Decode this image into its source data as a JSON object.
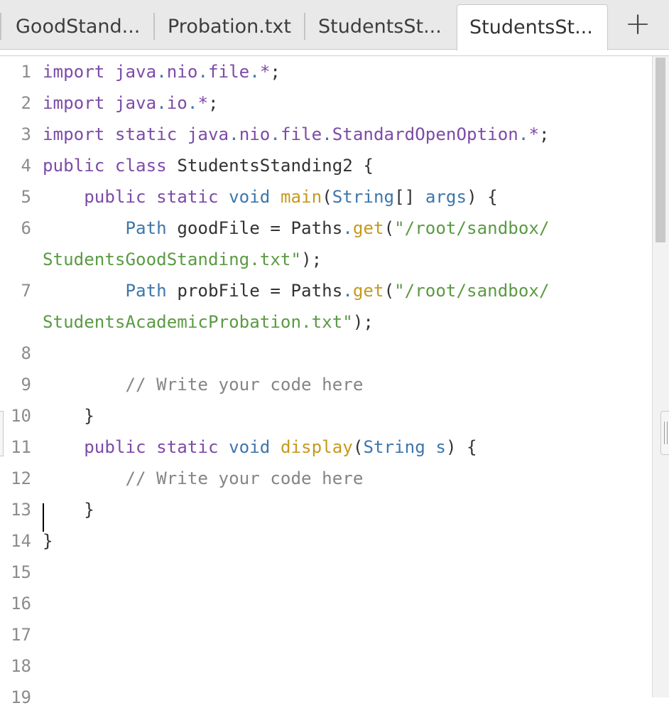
{
  "tabs": [
    {
      "label": "GoodStand...",
      "active": false
    },
    {
      "label": "Probation.txt",
      "active": false
    },
    {
      "label": "StudentsSt...",
      "active": false
    },
    {
      "label": "StudentsSt...",
      "active": true
    }
  ],
  "add_tab_label": "+",
  "editor": {
    "line_numbers": [
      "1",
      "2",
      "3",
      "4",
      "5",
      "6",
      "7",
      "8",
      "9",
      "10",
      "11",
      "12",
      "13",
      "14",
      "15",
      "16",
      "17",
      "18",
      "19"
    ],
    "lines": [
      [
        {
          "t": "import ",
          "c": "kw"
        },
        {
          "t": "java",
          "c": "kw"
        },
        {
          "t": ".",
          "c": "ty"
        },
        {
          "t": "nio",
          "c": "kw"
        },
        {
          "t": ".",
          "c": "ty"
        },
        {
          "t": "file",
          "c": "kw"
        },
        {
          "t": ".",
          "c": "ty"
        },
        {
          "t": "*",
          "c": "kw"
        },
        {
          "t": ";",
          "c": "pl"
        }
      ],
      [
        {
          "t": "import ",
          "c": "kw"
        },
        {
          "t": "java",
          "c": "kw"
        },
        {
          "t": ".",
          "c": "ty"
        },
        {
          "t": "io",
          "c": "kw"
        },
        {
          "t": ".",
          "c": "ty"
        },
        {
          "t": "*",
          "c": "kw"
        },
        {
          "t": ";",
          "c": "pl"
        }
      ],
      [
        {
          "t": "import static ",
          "c": "kw"
        },
        {
          "t": "java",
          "c": "kw"
        },
        {
          "t": ".",
          "c": "ty"
        },
        {
          "t": "nio",
          "c": "kw"
        },
        {
          "t": ".",
          "c": "ty"
        },
        {
          "t": "file",
          "c": "kw"
        },
        {
          "t": ".",
          "c": "ty"
        },
        {
          "t": "StandardOpenOption",
          "c": "kw"
        },
        {
          "t": ".",
          "c": "ty"
        },
        {
          "t": "*",
          "c": "kw"
        },
        {
          "t": ";",
          "c": "pl"
        }
      ],
      [
        {
          "t": "public class ",
          "c": "kw"
        },
        {
          "t": "StudentsStanding2 {",
          "c": "pl"
        }
      ],
      [
        {
          "t": "    ",
          "c": "pl"
        },
        {
          "t": "public static ",
          "c": "kw"
        },
        {
          "t": "void ",
          "c": "ty"
        },
        {
          "t": "main",
          "c": "fn"
        },
        {
          "t": "(",
          "c": "pl"
        },
        {
          "t": "String",
          "c": "ty"
        },
        {
          "t": "[] ",
          "c": "pl"
        },
        {
          "t": "args",
          "c": "ty"
        },
        {
          "t": ") {",
          "c": "pl"
        }
      ],
      [
        {
          "t": "        ",
          "c": "pl"
        },
        {
          "t": "Path ",
          "c": "ty"
        },
        {
          "t": "goodFile = Paths",
          "c": "pl"
        },
        {
          "t": ".",
          "c": "ty"
        },
        {
          "t": "get",
          "c": "fn"
        },
        {
          "t": "(",
          "c": "pl"
        },
        {
          "t": "\"/root/sandbox/",
          "c": "str"
        }
      ],
      [
        {
          "t": "StudentsGoodStanding.txt\"",
          "c": "str"
        },
        {
          "t": ");",
          "c": "pl"
        }
      ],
      [
        {
          "t": "        ",
          "c": "pl"
        },
        {
          "t": "Path ",
          "c": "ty"
        },
        {
          "t": "probFile = Paths",
          "c": "pl"
        },
        {
          "t": ".",
          "c": "ty"
        },
        {
          "t": "get",
          "c": "fn"
        },
        {
          "t": "(",
          "c": "pl"
        },
        {
          "t": "\"/root/sandbox/",
          "c": "str"
        }
      ],
      [
        {
          "t": "StudentsAcademicProbation.txt\"",
          "c": "str"
        },
        {
          "t": ");",
          "c": "pl"
        }
      ],
      [],
      [
        {
          "t": "        // Write your code here",
          "c": "cm"
        }
      ],
      [
        {
          "t": "    }",
          "c": "pl"
        }
      ],
      [
        {
          "t": "    ",
          "c": "pl"
        },
        {
          "t": "public static ",
          "c": "kw"
        },
        {
          "t": "void ",
          "c": "ty"
        },
        {
          "t": "display",
          "c": "fn"
        },
        {
          "t": "(",
          "c": "pl"
        },
        {
          "t": "String ",
          "c": "ty"
        },
        {
          "t": "s",
          "c": "ty"
        },
        {
          "t": ") {",
          "c": "pl"
        }
      ],
      [
        {
          "t": "        // Write your code here",
          "c": "cm"
        }
      ],
      [
        {
          "t": "    }",
          "c": "pl"
        }
      ],
      [
        {
          "t": "}",
          "c": "pl"
        }
      ],
      [],
      [],
      [],
      []
    ]
  },
  "colors": {
    "keyword": "#7d4ba8",
    "type": "#3e76ab",
    "function": "#c59a1e",
    "string": "#5b9a44",
    "comment": "#858585",
    "plain": "#333333"
  }
}
